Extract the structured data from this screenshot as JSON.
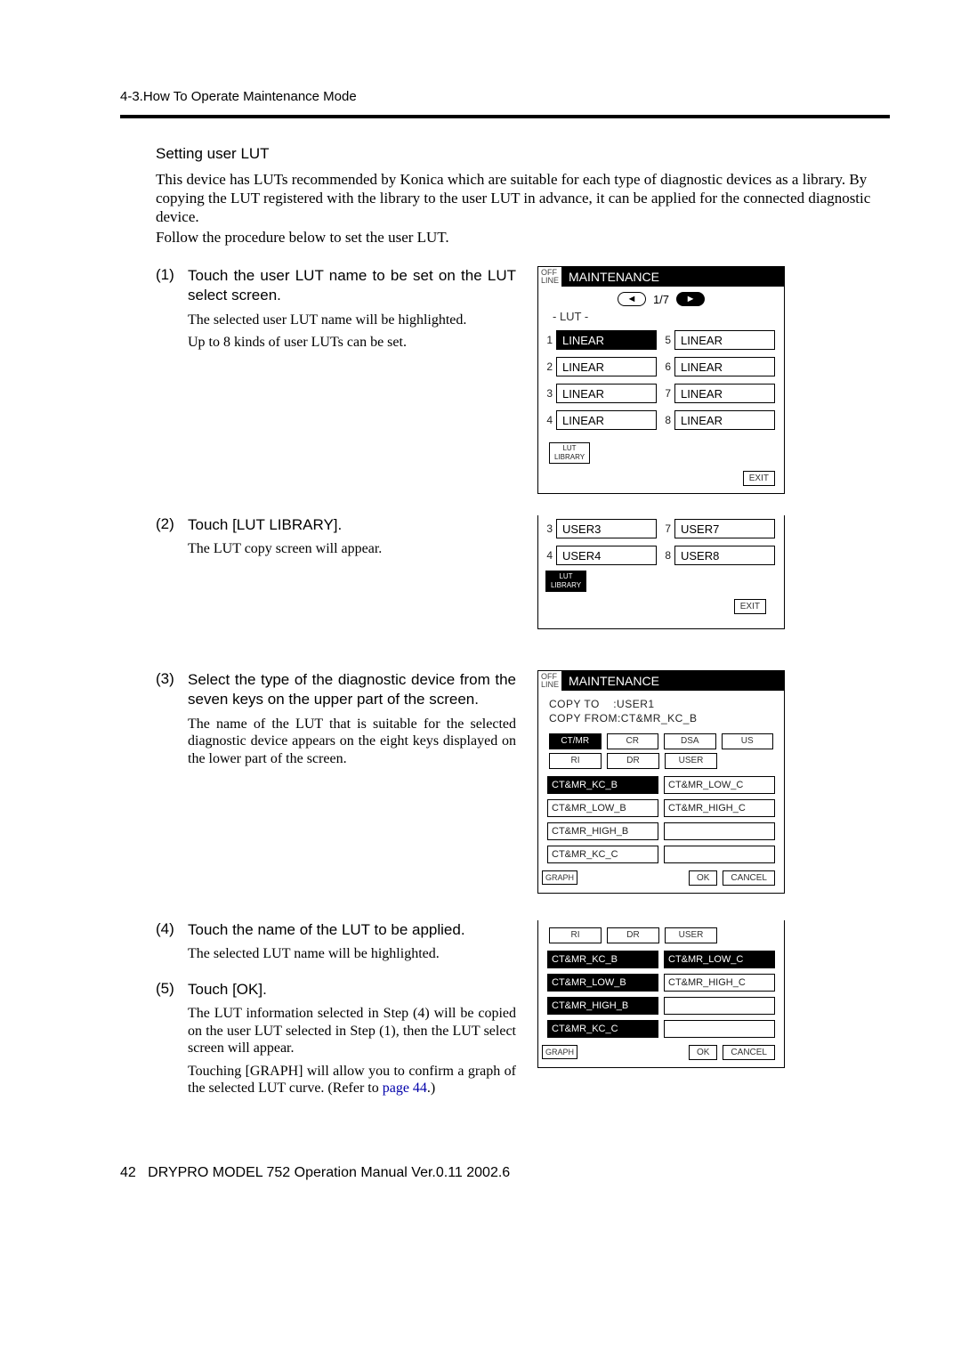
{
  "header": "4-3.How To Operate Maintenance Mode",
  "section": {
    "title": "Setting user LUT",
    "para1": "This device has LUTs recommended by Konica which are suitable for each type of diagnostic devices as a library. By copying the LUT registered with the library to the user LUT in advance, it can be applied for the connected diagnostic device.",
    "para2": "Follow the procedure below to set the user LUT."
  },
  "steps": {
    "s1": {
      "num": "(1)",
      "title": "Touch the user LUT name to be set on the LUT select screen.",
      "body1": "The selected user LUT name will be highlighted.",
      "body2": "Up to 8 kinds of user LUTs can be set."
    },
    "s2": {
      "num": "(2)",
      "title": "Touch [LUT LIBRARY].",
      "body1": "The LUT copy screen will appear."
    },
    "s3": {
      "num": "(3)",
      "title": "Select the type of the diagnostic device from the seven keys on the upper part of the screen.",
      "body1": "The name of the LUT that is suitable for the selected diagnostic device appears on the eight keys displayed on the lower part of the screen."
    },
    "s4": {
      "num": "(4)",
      "title": "Touch the name of the LUT to be applied.",
      "body1": "The selected LUT name will be highlighted."
    },
    "s5": {
      "num": "(5)",
      "title": "Touch [OK].",
      "body1": "The LUT information selected in Step (4) will be copied on the user LUT selected in Step (1), then the LUT select screen will appear.",
      "body2a": "Touching [GRAPH] will allow you to confirm a graph of the selected LUT curve. (Refer to ",
      "body2link": "page 44",
      "body2b": ".)"
    }
  },
  "panel1": {
    "offline1": "OFF",
    "offline2": "LINE",
    "title": "MAINTENANCE",
    "page": "1/7",
    "label": "- LUT -",
    "items": {
      "n1": "1",
      "v1": "LINEAR",
      "n5": "5",
      "v5": "LINEAR",
      "n2": "2",
      "v2": "LINEAR",
      "n6": "6",
      "v6": "LINEAR",
      "n3": "3",
      "v3": "LINEAR",
      "n7": "7",
      "v7": "LINEAR",
      "n4": "4",
      "v4": "LINEAR",
      "n8": "8",
      "v8": "LINEAR"
    },
    "lib1": "LUT",
    "lib2": "LIBRARY",
    "exit": "EXIT"
  },
  "panel2": {
    "items": {
      "n3": "3",
      "v3": "USER3",
      "n7": "7",
      "v7": "USER7",
      "n4": "4",
      "v4": "USER4",
      "n8": "8",
      "v8": "USER8"
    },
    "lib1": "LUT",
    "lib2": "LIBRARY",
    "exit": "EXIT"
  },
  "panel3": {
    "offline1": "OFF",
    "offline2": "LINE",
    "title": "MAINTENANCE",
    "copyto_l": "COPY TO",
    "copyto_v": ":USER1",
    "copyfrom": "COPY FROM:CT&MR_KC_B",
    "types1": {
      "a": "CT/MR",
      "b": "CR",
      "c": "DSA",
      "d": "US"
    },
    "types2": {
      "a": "RI",
      "b": "DR",
      "c": "USER"
    },
    "luts": {
      "l1": "CT&MR_KC_B",
      "r1": "CT&MR_LOW_C",
      "l2": "CT&MR_LOW_B",
      "r2": "CT&MR_HIGH_C",
      "l3": "CT&MR_HIGH_B",
      "r3": "",
      "l4": "CT&MR_KC_C",
      "r4": ""
    },
    "graph": "GRAPH",
    "ok": "OK",
    "cancel": "CANCEL"
  },
  "panel4": {
    "types2": {
      "a": "RI",
      "b": "DR",
      "c": "USER"
    },
    "luts": {
      "l1": "CT&MR_KC_B",
      "r1": "CT&MR_LOW_C",
      "l2": "CT&MR_LOW_B",
      "r2": "CT&MR_HIGH_C",
      "l3": "CT&MR_HIGH_B",
      "r3": "",
      "l4": "CT&MR_KC_C",
      "r4": ""
    },
    "graph": "GRAPH",
    "ok": "OK",
    "cancel": "CANCEL"
  },
  "footer": {
    "pagenum": "42",
    "text": "DRYPRO MODEL 752 Operation Manual Ver.0.11 2002.6"
  }
}
